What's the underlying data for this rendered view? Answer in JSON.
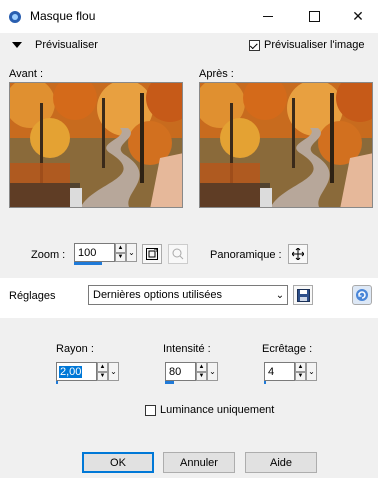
{
  "window": {
    "title": "Masque flou"
  },
  "preview_section": {
    "collapse_label": "Prévisualiser",
    "preview_checkbox_label": "Prévisualiser l'image",
    "preview_checked": true,
    "before_label": "Avant :",
    "after_label": "Après :",
    "zoom_label": "Zoom :",
    "zoom_value": "100",
    "pan_label": "Panoramique :"
  },
  "presets": {
    "label": "Réglages",
    "selected": "Dernières options utilisées"
  },
  "params": {
    "radius_label": "Rayon :",
    "radius_value": "2,00",
    "intensity_label": "Intensité :",
    "intensity_value": "80",
    "clip_label": "Ecrêtage :",
    "clip_value": "4",
    "luminance_label": "Luminance uniquement",
    "luminance_checked": false
  },
  "buttons": {
    "ok": "OK",
    "cancel": "Annuler",
    "help": "Aide"
  },
  "colors": {
    "accent": "#0078d7",
    "progress": "#1f7ad8"
  }
}
